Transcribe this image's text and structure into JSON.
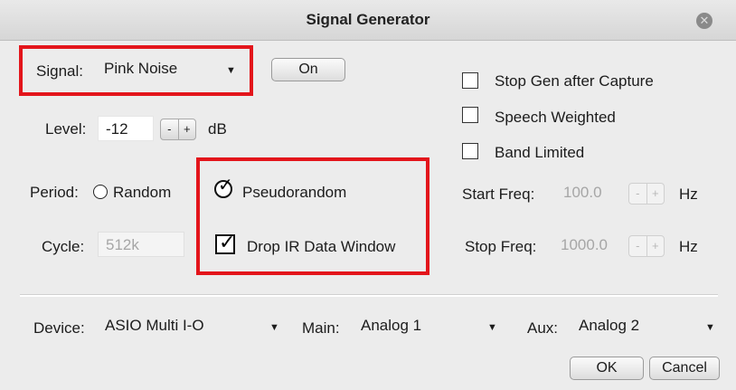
{
  "window": {
    "title": "Signal Generator"
  },
  "signal": {
    "label": "Signal:",
    "value": "Pink Noise",
    "on_button": "On"
  },
  "level": {
    "label": "Level:",
    "value": "-12",
    "unit": "dB",
    "minus": "-",
    "plus": "+"
  },
  "period": {
    "label": "Period:",
    "random": "Random",
    "pseudorandom": "Pseudorandom",
    "selected": "Pseudorandom"
  },
  "cycle": {
    "label": "Cycle:",
    "value": "512k"
  },
  "drop_ir": {
    "label": "Drop IR Data Window",
    "checked": true
  },
  "options": {
    "stop_gen": {
      "label": "Stop Gen after Capture",
      "checked": false
    },
    "speech_weighted": {
      "label": "Speech Weighted",
      "checked": false
    },
    "band_limited": {
      "label": "Band Limited",
      "checked": false
    }
  },
  "start_freq": {
    "label": "Start Freq:",
    "value": "100.0",
    "unit": "Hz",
    "minus": "-",
    "plus": "+"
  },
  "stop_freq": {
    "label": "Stop Freq:",
    "value": "1000.0",
    "unit": "Hz",
    "minus": "-",
    "plus": "+"
  },
  "device": {
    "label": "Device:",
    "value": "ASIO Multi I-O"
  },
  "main": {
    "label": "Main:",
    "value": "Analog 1"
  },
  "aux": {
    "label": "Aux:",
    "value": "Analog 2"
  },
  "buttons": {
    "ok": "OK",
    "cancel": "Cancel"
  },
  "highlight_color": "#e3151b"
}
